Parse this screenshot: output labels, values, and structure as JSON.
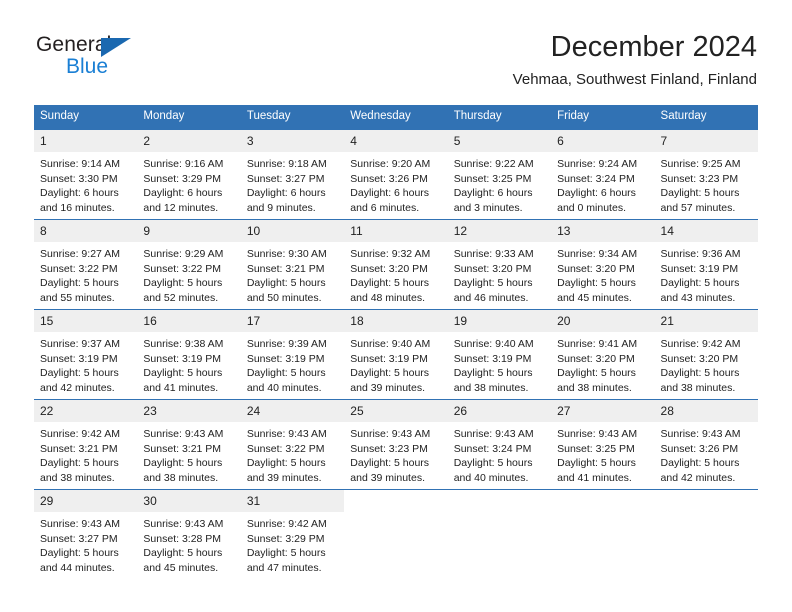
{
  "brand": {
    "name_part1": "General",
    "name_part2": "Blue",
    "logo_icon": "triangle-flag-icon"
  },
  "header": {
    "month_title": "December 2024",
    "location": "Vehmaa, Southwest Finland, Finland"
  },
  "colors": {
    "header_blue": "#3172b4",
    "brand_blue": "#1a7fd4",
    "logo_blue": "#1a68b0",
    "daynum_bg": "#efefef",
    "text": "#222222"
  },
  "calendar": {
    "weekday_headers": [
      "Sunday",
      "Monday",
      "Tuesday",
      "Wednesday",
      "Thursday",
      "Friday",
      "Saturday"
    ],
    "weeks": [
      [
        {
          "day": "1",
          "sunrise": "Sunrise: 9:14 AM",
          "sunset": "Sunset: 3:30 PM",
          "daylight": "Daylight: 6 hours and 16 minutes."
        },
        {
          "day": "2",
          "sunrise": "Sunrise: 9:16 AM",
          "sunset": "Sunset: 3:29 PM",
          "daylight": "Daylight: 6 hours and 12 minutes."
        },
        {
          "day": "3",
          "sunrise": "Sunrise: 9:18 AM",
          "sunset": "Sunset: 3:27 PM",
          "daylight": "Daylight: 6 hours and 9 minutes."
        },
        {
          "day": "4",
          "sunrise": "Sunrise: 9:20 AM",
          "sunset": "Sunset: 3:26 PM",
          "daylight": "Daylight: 6 hours and 6 minutes."
        },
        {
          "day": "5",
          "sunrise": "Sunrise: 9:22 AM",
          "sunset": "Sunset: 3:25 PM",
          "daylight": "Daylight: 6 hours and 3 minutes."
        },
        {
          "day": "6",
          "sunrise": "Sunrise: 9:24 AM",
          "sunset": "Sunset: 3:24 PM",
          "daylight": "Daylight: 6 hours and 0 minutes."
        },
        {
          "day": "7",
          "sunrise": "Sunrise: 9:25 AM",
          "sunset": "Sunset: 3:23 PM",
          "daylight": "Daylight: 5 hours and 57 minutes."
        }
      ],
      [
        {
          "day": "8",
          "sunrise": "Sunrise: 9:27 AM",
          "sunset": "Sunset: 3:22 PM",
          "daylight": "Daylight: 5 hours and 55 minutes."
        },
        {
          "day": "9",
          "sunrise": "Sunrise: 9:29 AM",
          "sunset": "Sunset: 3:22 PM",
          "daylight": "Daylight: 5 hours and 52 minutes."
        },
        {
          "day": "10",
          "sunrise": "Sunrise: 9:30 AM",
          "sunset": "Sunset: 3:21 PM",
          "daylight": "Daylight: 5 hours and 50 minutes."
        },
        {
          "day": "11",
          "sunrise": "Sunrise: 9:32 AM",
          "sunset": "Sunset: 3:20 PM",
          "daylight": "Daylight: 5 hours and 48 minutes."
        },
        {
          "day": "12",
          "sunrise": "Sunrise: 9:33 AM",
          "sunset": "Sunset: 3:20 PM",
          "daylight": "Daylight: 5 hours and 46 minutes."
        },
        {
          "day": "13",
          "sunrise": "Sunrise: 9:34 AM",
          "sunset": "Sunset: 3:20 PM",
          "daylight": "Daylight: 5 hours and 45 minutes."
        },
        {
          "day": "14",
          "sunrise": "Sunrise: 9:36 AM",
          "sunset": "Sunset: 3:19 PM",
          "daylight": "Daylight: 5 hours and 43 minutes."
        }
      ],
      [
        {
          "day": "15",
          "sunrise": "Sunrise: 9:37 AM",
          "sunset": "Sunset: 3:19 PM",
          "daylight": "Daylight: 5 hours and 42 minutes."
        },
        {
          "day": "16",
          "sunrise": "Sunrise: 9:38 AM",
          "sunset": "Sunset: 3:19 PM",
          "daylight": "Daylight: 5 hours and 41 minutes."
        },
        {
          "day": "17",
          "sunrise": "Sunrise: 9:39 AM",
          "sunset": "Sunset: 3:19 PM",
          "daylight": "Daylight: 5 hours and 40 minutes."
        },
        {
          "day": "18",
          "sunrise": "Sunrise: 9:40 AM",
          "sunset": "Sunset: 3:19 PM",
          "daylight": "Daylight: 5 hours and 39 minutes."
        },
        {
          "day": "19",
          "sunrise": "Sunrise: 9:40 AM",
          "sunset": "Sunset: 3:19 PM",
          "daylight": "Daylight: 5 hours and 38 minutes."
        },
        {
          "day": "20",
          "sunrise": "Sunrise: 9:41 AM",
          "sunset": "Sunset: 3:20 PM",
          "daylight": "Daylight: 5 hours and 38 minutes."
        },
        {
          "day": "21",
          "sunrise": "Sunrise: 9:42 AM",
          "sunset": "Sunset: 3:20 PM",
          "daylight": "Daylight: 5 hours and 38 minutes."
        }
      ],
      [
        {
          "day": "22",
          "sunrise": "Sunrise: 9:42 AM",
          "sunset": "Sunset: 3:21 PM",
          "daylight": "Daylight: 5 hours and 38 minutes."
        },
        {
          "day": "23",
          "sunrise": "Sunrise: 9:43 AM",
          "sunset": "Sunset: 3:21 PM",
          "daylight": "Daylight: 5 hours and 38 minutes."
        },
        {
          "day": "24",
          "sunrise": "Sunrise: 9:43 AM",
          "sunset": "Sunset: 3:22 PM",
          "daylight": "Daylight: 5 hours and 39 minutes."
        },
        {
          "day": "25",
          "sunrise": "Sunrise: 9:43 AM",
          "sunset": "Sunset: 3:23 PM",
          "daylight": "Daylight: 5 hours and 39 minutes."
        },
        {
          "day": "26",
          "sunrise": "Sunrise: 9:43 AM",
          "sunset": "Sunset: 3:24 PM",
          "daylight": "Daylight: 5 hours and 40 minutes."
        },
        {
          "day": "27",
          "sunrise": "Sunrise: 9:43 AM",
          "sunset": "Sunset: 3:25 PM",
          "daylight": "Daylight: 5 hours and 41 minutes."
        },
        {
          "day": "28",
          "sunrise": "Sunrise: 9:43 AM",
          "sunset": "Sunset: 3:26 PM",
          "daylight": "Daylight: 5 hours and 42 minutes."
        }
      ],
      [
        {
          "day": "29",
          "sunrise": "Sunrise: 9:43 AM",
          "sunset": "Sunset: 3:27 PM",
          "daylight": "Daylight: 5 hours and 44 minutes."
        },
        {
          "day": "30",
          "sunrise": "Sunrise: 9:43 AM",
          "sunset": "Sunset: 3:28 PM",
          "daylight": "Daylight: 5 hours and 45 minutes."
        },
        {
          "day": "31",
          "sunrise": "Sunrise: 9:42 AM",
          "sunset": "Sunset: 3:29 PM",
          "daylight": "Daylight: 5 hours and 47 minutes."
        },
        {
          "day": "",
          "sunrise": "",
          "sunset": "",
          "daylight": ""
        },
        {
          "day": "",
          "sunrise": "",
          "sunset": "",
          "daylight": ""
        },
        {
          "day": "",
          "sunrise": "",
          "sunset": "",
          "daylight": ""
        },
        {
          "day": "",
          "sunrise": "",
          "sunset": "",
          "daylight": ""
        }
      ]
    ]
  }
}
